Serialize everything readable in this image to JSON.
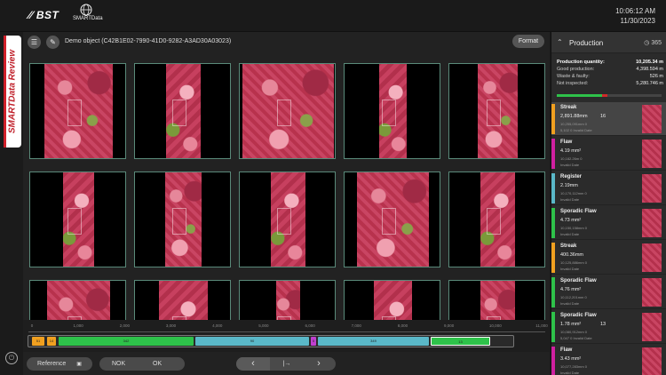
{
  "brand": {
    "bst": "BST",
    "smart": "SMARTData"
  },
  "clock": {
    "time": "10:06:12 AM",
    "date": "11/30/2023"
  },
  "sidebar_tab": {
    "part1": "SMART",
    "part2": "Data Review"
  },
  "toolbar": {
    "object_title": "Demo object (C42B1E02-7990-41D0-9282-A3AD30A03023)",
    "format_label": "Format"
  },
  "timeline": {
    "ticks": [
      "0",
      "1,000",
      "2,000",
      "3,000",
      "4,000",
      "5,000",
      "6,000",
      "7,000",
      "8,000",
      "9,000",
      "10,000",
      "11,000"
    ],
    "segment_labels": [
      "51",
      "14",
      "342",
      "90",
      "5",
      "349",
      "13"
    ]
  },
  "bottom": {
    "reference_label": "Reference",
    "nok_label": "NOK",
    "ok_label": "OK"
  },
  "panel": {
    "title": "Production",
    "count": "365",
    "stats": [
      {
        "k": "Production quantity:",
        "v": "10,205.34 m"
      },
      {
        "k": "Good production:",
        "v": "4,398.594 m"
      },
      {
        "k": "Waste & faulty:",
        "v": "526 m"
      },
      {
        "k": "Not inspected:",
        "v": "5,280.746 m"
      }
    ],
    "progress": {
      "good_fraction": 0.43,
      "waste_fraction": 0.05
    },
    "items": [
      {
        "name": "Streak",
        "value": "2,891.88mm",
        "extra": "16",
        "sub": "10,255,091mm  0",
        "sub2": "5,102      0      Invalid Date",
        "color": "#f0a020",
        "selected": true
      },
      {
        "name": "Flaw",
        "value": "4.19 mm²",
        "extra": "",
        "sub": "10,182.26m  0",
        "sub2": "               Invalid Date",
        "color": "#d020a0",
        "selected": false
      },
      {
        "name": "Register",
        "value": "2.19mm",
        "extra": "",
        "sub": "10,170,112mm  0",
        "sub2": "               Invalid Date",
        "color": "#5ab8c8",
        "selected": false
      },
      {
        "name": "Sporadic Flaw",
        "value": "4.73 mm²",
        "extra": "",
        "sub": "10,150,158mm  0",
        "sub2": "               Invalid Date",
        "color": "#2ec24a",
        "selected": false
      },
      {
        "name": "Streak",
        "value": "400.36mm",
        "extra": "",
        "sub": "10,125,886mm  0",
        "sub2": "               Invalid Date",
        "color": "#f0a020",
        "selected": false
      },
      {
        "name": "Sporadic Flaw",
        "value": "4.76 mm²",
        "extra": "",
        "sub": "10,112,201mm  0",
        "sub2": "               Invalid Date",
        "color": "#2ec24a",
        "selected": false
      },
      {
        "name": "Sporadic Flaw",
        "value": "1.78 mm²",
        "extra": "13",
        "sub": "10,080,912mm  0",
        "sub2": "5,047      0      Invalid Date",
        "color": "#2ec24a",
        "selected": false
      },
      {
        "name": "Flaw",
        "value": "3.43 mm²",
        "extra": "",
        "sub": "10,077,283mm  0",
        "sub2": "               Invalid Date",
        "color": "#d020a0",
        "selected": false
      }
    ]
  },
  "colors": {
    "green": "#2ec24a",
    "teal": "#5ab8c8",
    "orange": "#f0a020",
    "magenta": "#d020a0",
    "brand_red": "#d0202a"
  }
}
